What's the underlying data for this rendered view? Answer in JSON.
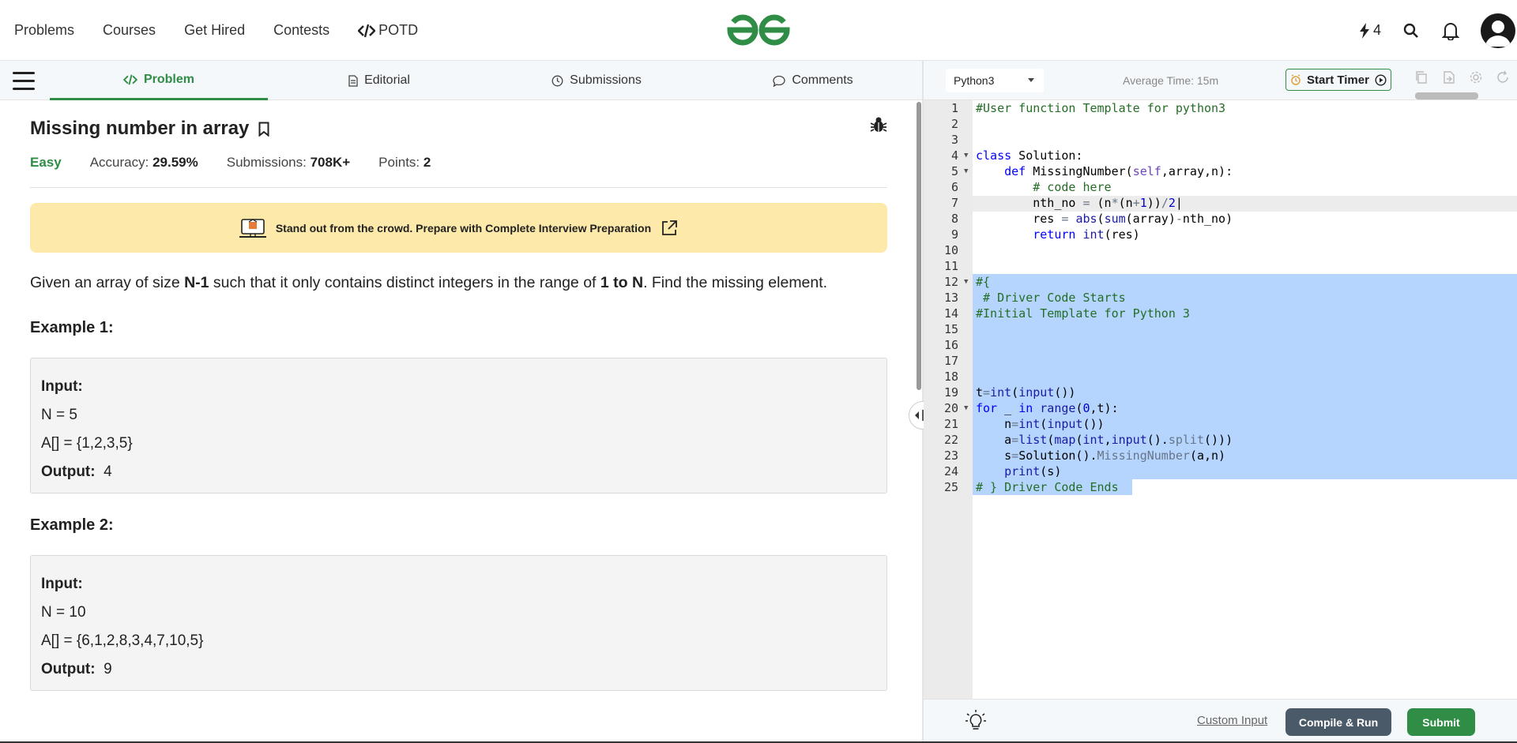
{
  "nav": {
    "links": [
      "Problems",
      "Courses",
      "Get Hired",
      "Contests"
    ],
    "potd": "POTD",
    "potd_icon": "code-icon",
    "streak": "4"
  },
  "tabs": {
    "problem": "Problem",
    "editorial": "Editorial",
    "submissions": "Submissions",
    "comments": "Comments"
  },
  "problem": {
    "title": "Missing number in array",
    "difficulty": "Easy",
    "accuracy_label": "Accuracy:",
    "accuracy": "29.59%",
    "submissions_label": "Submissions:",
    "submissions": "708K+",
    "points_label": "Points:",
    "points": "2",
    "banner": "Stand out from the crowd. Prepare with Complete Interview Preparation",
    "desc_1": "Given an array of size ",
    "desc_n1": "N-1",
    "desc_2": " such that it only contains distinct integers in the range of ",
    "desc_range": "1 to N",
    "desc_3": ". Find the missing element.",
    "examples": [
      {
        "title": "Example 1:",
        "input_label": "Input:",
        "n_line": "N = 5",
        "a_line": "A[] = {1,2,3,5}",
        "output_label": "Output:",
        "output": "4"
      },
      {
        "title": "Example 2:",
        "input_label": "Input:",
        "n_line": "N = 10",
        "a_line": "A[] = {6,1,2,8,3,4,7,10,5}",
        "output_label": "Output:",
        "output": "9"
      }
    ]
  },
  "editor": {
    "language": "Python3",
    "avg_time": "Average Time: 15m",
    "timer": "Start Timer",
    "custom_input": "Custom Input",
    "compile": "Compile & Run",
    "submit": "Submit"
  },
  "colors": {
    "brand_green": "#2f8d46",
    "selection": "#b5d5ff",
    "banner": "#fde9a9"
  }
}
